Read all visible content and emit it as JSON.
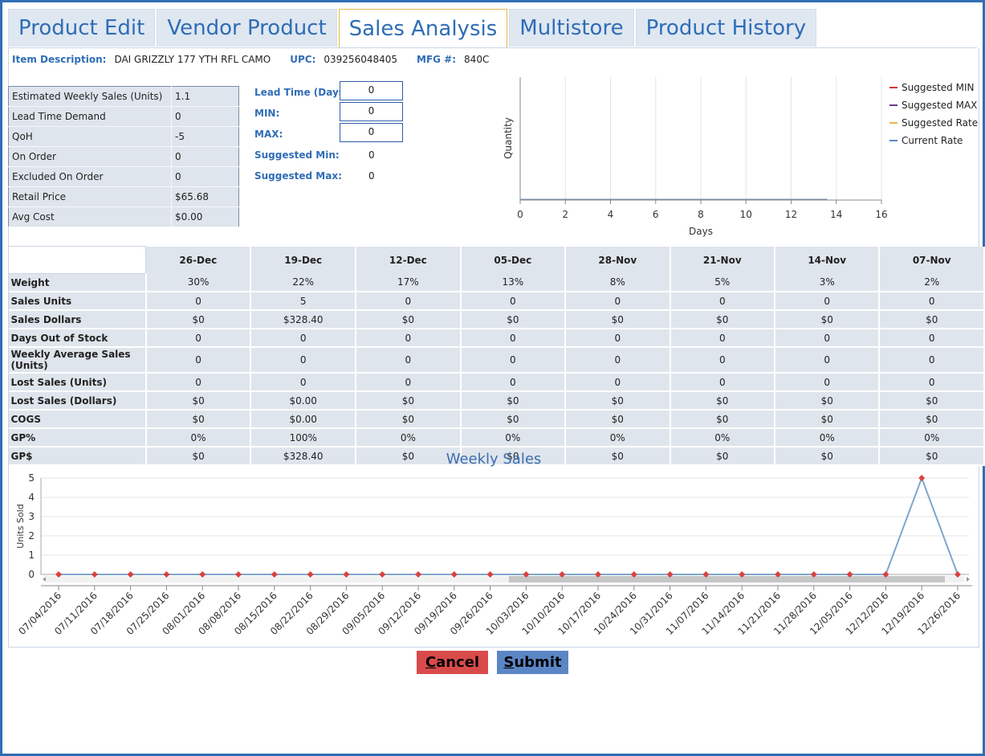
{
  "tabs": [
    "Product Edit",
    "Vendor Product",
    "Sales Analysis",
    "Multistore",
    "Product History"
  ],
  "active_tab": "Sales Analysis",
  "item": {
    "desc_label": "Item Description:",
    "desc_value": "DAI GRIZZLY 177 YTH RFL CAMO",
    "upc_label": "UPC:",
    "upc_value": "039256048405",
    "mfg_label": "MFG #:",
    "mfg_value": "840C"
  },
  "stats": [
    {
      "k": "Estimated Weekly Sales (Units)",
      "v": "1.1"
    },
    {
      "k": "Lead Time Demand",
      "v": "0"
    },
    {
      "k": "QoH",
      "v": "-5"
    },
    {
      "k": "On Order",
      "v": "0"
    },
    {
      "k": "Excluded On Order",
      "v": "0"
    },
    {
      "k": "Retail Price",
      "v": "$65.68"
    },
    {
      "k": "Avg Cost",
      "v": "$0.00"
    }
  ],
  "lead": {
    "lead_label": "Lead Time (Days):",
    "lead_value": "0",
    "min_label": "MIN:",
    "min_value": "0",
    "max_label": "MAX:",
    "max_value": "0",
    "smin_label": "Suggested Min:",
    "smin_value": "0",
    "smax_label": "Suggested Max:",
    "smax_value": "0"
  },
  "chart_data": [
    {
      "type": "line",
      "title": "",
      "xlabel": "Days",
      "ylabel": "Quantity",
      "xlim": [
        0,
        16
      ],
      "x_ticks": [
        "0",
        "2",
        "4",
        "6",
        "8",
        "10",
        "12",
        "14",
        "16"
      ],
      "legend_position": "right",
      "series": [
        {
          "name": "Suggested MIN",
          "color": "#d9322e",
          "x": [
            0,
            13.6
          ],
          "values": [
            0,
            0
          ]
        },
        {
          "name": "Suggested MAX",
          "color": "#6b3a8a",
          "x": [
            0,
            13.6
          ],
          "values": [
            0,
            0
          ]
        },
        {
          "name": "Suggested Rate",
          "color": "#e8b84a",
          "x": [
            0,
            13.6
          ],
          "values": [
            0,
            0
          ]
        },
        {
          "name": "Current Rate",
          "color": "#5b8ac0",
          "x": [
            0,
            13.6
          ],
          "values": [
            0,
            0
          ]
        }
      ]
    },
    {
      "type": "line",
      "title": "Weekly Sales",
      "xlabel": "",
      "ylabel": "Units Sold",
      "ylim": [
        0,
        5
      ],
      "y_ticks": [
        "0",
        "1",
        "2",
        "3",
        "4",
        "5"
      ],
      "categories": [
        "07/04/2016",
        "07/11/2016",
        "07/18/2016",
        "07/25/2016",
        "08/01/2016",
        "08/08/2016",
        "08/15/2016",
        "08/22/2016",
        "08/29/2016",
        "09/05/2016",
        "09/12/2016",
        "09/19/2016",
        "09/26/2016",
        "10/03/2016",
        "10/10/2016",
        "10/17/2016",
        "10/24/2016",
        "10/31/2016",
        "11/07/2016",
        "11/14/2016",
        "11/21/2016",
        "11/28/2016",
        "12/05/2016",
        "12/12/2016",
        "12/19/2016",
        "12/26/2016"
      ],
      "values": [
        0,
        0,
        0,
        0,
        0,
        0,
        0,
        0,
        0,
        0,
        0,
        0,
        0,
        0,
        0,
        0,
        0,
        0,
        0,
        0,
        0,
        0,
        0,
        0,
        5,
        0
      ],
      "line_color": "#7ea6cf",
      "marker_color": "#d9423e"
    }
  ],
  "weekly_table": {
    "columns": [
      "26-Dec",
      "19-Dec",
      "12-Dec",
      "05-Dec",
      "28-Nov",
      "21-Nov",
      "14-Nov",
      "07-Nov"
    ],
    "rows": [
      {
        "label": "Weight",
        "cells": [
          "30%",
          "22%",
          "17%",
          "13%",
          "8%",
          "5%",
          "3%",
          "2%"
        ]
      },
      {
        "label": "Sales Units",
        "cells": [
          "0",
          "5",
          "0",
          "0",
          "0",
          "0",
          "0",
          "0"
        ]
      },
      {
        "label": "Sales Dollars",
        "cells": [
          "$0",
          "$328.40",
          "$0",
          "$0",
          "$0",
          "$0",
          "$0",
          "$0"
        ]
      },
      {
        "label": "Days Out of Stock",
        "cells": [
          "0",
          "0",
          "0",
          "0",
          "0",
          "0",
          "0",
          "0"
        ]
      },
      {
        "label": "Weekly Average Sales (Units)",
        "cells": [
          "0",
          "0",
          "0",
          "0",
          "0",
          "0",
          "0",
          "0"
        ]
      },
      {
        "label": "Lost Sales (Units)",
        "cells": [
          "0",
          "0",
          "0",
          "0",
          "0",
          "0",
          "0",
          "0"
        ]
      },
      {
        "label": "Lost Sales (Dollars)",
        "cells": [
          "$0",
          "$0.00",
          "$0",
          "$0",
          "$0",
          "$0",
          "$0",
          "$0"
        ]
      },
      {
        "label": "COGS",
        "cells": [
          "$0",
          "$0.00",
          "$0",
          "$0",
          "$0",
          "$0",
          "$0",
          "$0"
        ]
      },
      {
        "label": "GP%",
        "cells": [
          "0%",
          "100%",
          "0%",
          "0%",
          "0%",
          "0%",
          "0%",
          "0%"
        ]
      },
      {
        "label": "GP$",
        "cells": [
          "$0",
          "$328.40",
          "$0",
          "$0",
          "$0",
          "$0",
          "$0",
          "$0"
        ]
      }
    ]
  },
  "buttons": {
    "cancel": "Cancel",
    "cancel_color": "#d94b4b",
    "submit": "Submit",
    "submit_color": "#5b86c6"
  },
  "colors": {
    "accent": "#2f6db5",
    "active_tab_border": "#e2b84a"
  }
}
